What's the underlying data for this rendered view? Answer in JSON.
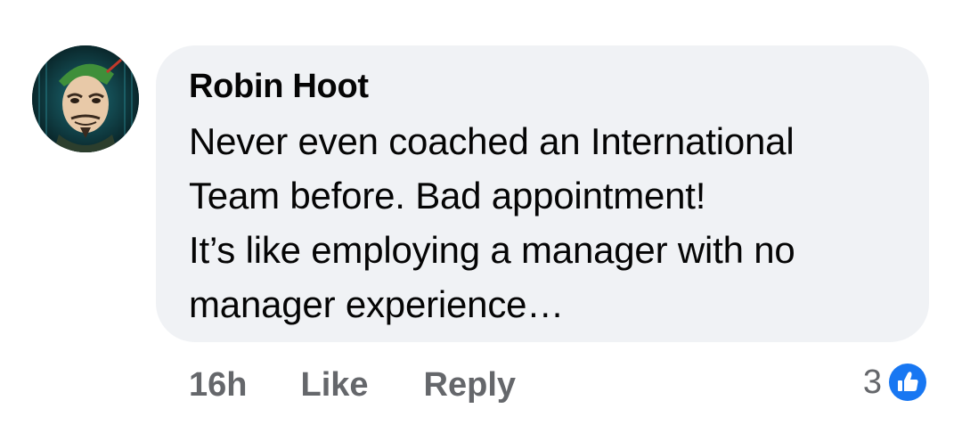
{
  "comment": {
    "author": "Robin Hoot",
    "lines": [
      "Never even coached an International",
      "Team before. Bad appointment!",
      "It’s like employing a manager with no",
      "manager experience…"
    ],
    "timestamp": "16h",
    "like_label": "Like",
    "reply_label": "Reply",
    "reaction_count": "3",
    "reaction_icon": "thumbs-up-icon",
    "avatar_icon": "masked-face-avatar"
  },
  "colors": {
    "bubble_bg": "#f0f2f5",
    "text": "#050505",
    "secondary_text": "#65676b",
    "like_blue": "#1877f2"
  }
}
